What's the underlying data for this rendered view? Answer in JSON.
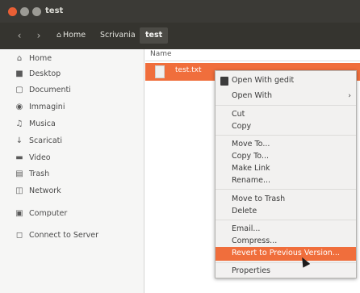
{
  "window": {
    "title": "test"
  },
  "toolbar": {
    "back_glyph": "‹",
    "forward_glyph": "›",
    "breadcrumbs": [
      "Home",
      "Scrivania",
      "test"
    ],
    "home_icon_glyph": "⌂"
  },
  "sidebar": {
    "items": [
      {
        "label": "Home",
        "icon": "home-icon",
        "glyph": "⌂"
      },
      {
        "label": "Desktop",
        "icon": "folder-icon",
        "glyph": "■"
      },
      {
        "label": "Documenti",
        "icon": "document-icon",
        "glyph": "▢"
      },
      {
        "label": "Immagini",
        "icon": "camera-icon",
        "glyph": "◉"
      },
      {
        "label": "Musica",
        "icon": "music-icon",
        "glyph": "♫"
      },
      {
        "label": "Scaricati",
        "icon": "download-icon",
        "glyph": "↓"
      },
      {
        "label": "Video",
        "icon": "video-icon",
        "glyph": "▬"
      },
      {
        "label": "Trash",
        "icon": "trash-icon",
        "glyph": "▤"
      },
      {
        "label": "Network",
        "icon": "network-icon",
        "glyph": "◫"
      },
      {
        "label": "Computer",
        "icon": "computer-icon",
        "glyph": "▣"
      },
      {
        "label": "Connect to Server",
        "icon": "server-icon",
        "glyph": "◻"
      }
    ]
  },
  "main": {
    "column_header": "Name",
    "file": {
      "name": "test.txt",
      "icon": "text-file-icon"
    }
  },
  "context_menu": {
    "items": [
      {
        "label": "Open With gedit",
        "icon": "gedit-icon"
      },
      {
        "label": "Open With",
        "has_submenu": true
      },
      {
        "label": "Cut"
      },
      {
        "label": "Copy"
      },
      {
        "label": "Move To..."
      },
      {
        "label": "Copy To..."
      },
      {
        "label": "Make Link"
      },
      {
        "label": "Rename..."
      },
      {
        "label": "Move to Trash"
      },
      {
        "label": "Delete"
      },
      {
        "label": "Email..."
      },
      {
        "label": "Compress..."
      },
      {
        "label": "Revert to Previous Version...",
        "highlighted": true
      },
      {
        "label": "Properties"
      }
    ],
    "submenu_glyph": "›"
  },
  "colors": {
    "accent": "#f06e3c",
    "titlebar": "#3b3a36",
    "sidebar_bg": "#f6f6f5",
    "menu_bg": "#f2f1f0"
  }
}
